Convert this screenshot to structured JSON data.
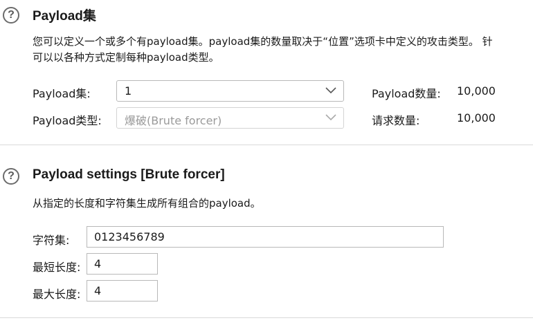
{
  "payload_sets": {
    "title": "Payload集",
    "description_line1": "您可以定义一个或多个有payload集。payload集的数量取决于“位置”选项卡中定义的攻击类型。 针",
    "description_line2": "可以以各种方式定制每种payload类型。",
    "set_label": "Payload集:",
    "set_value": "1",
    "type_label": "Payload类型:",
    "type_value": "爆破(Brute forcer)",
    "count_label": "Payload数量:",
    "count_value": "10,000",
    "request_label": "请求数量:",
    "request_value": "10,000"
  },
  "payload_settings": {
    "title": "Payload settings [Brute forcer]",
    "description": "从指定的长度和字符集生成所有组合的payload。",
    "charset_label": "字符集:",
    "charset_value": "0123456789",
    "min_label": "最短长度:",
    "min_value": "4",
    "max_label": "最大长度:",
    "max_value": "4"
  },
  "icons": {
    "help": "?"
  }
}
